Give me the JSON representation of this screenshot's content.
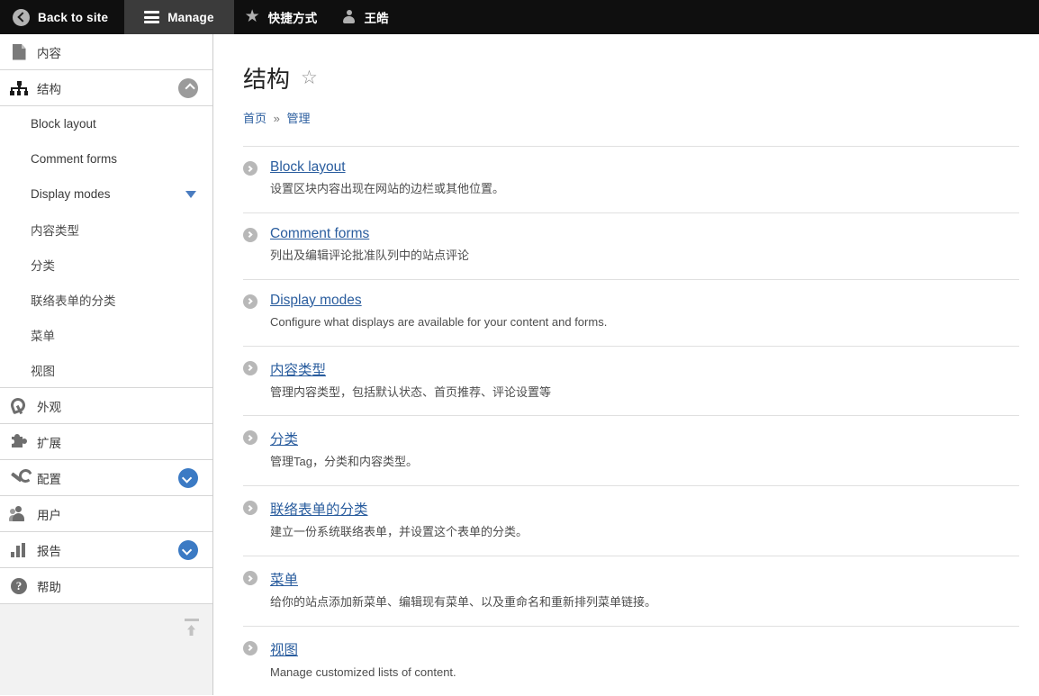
{
  "toolbar": {
    "back_label": "Back to site",
    "back_icon": "circle-left-chevron-icon",
    "manage_label": "Manage",
    "manage_icon": "hamburger-icon",
    "shortcuts_label": "快捷方式",
    "shortcuts_icon": "star-icon",
    "account_label": "王皓",
    "account_icon": "person-icon",
    "active_tab": "Manage"
  },
  "sidebar": {
    "items": [
      {
        "label": "内容",
        "icon": "document-icon",
        "toggle": null
      },
      {
        "label": "结构",
        "icon": "structure-tree-icon",
        "toggle": "chevron-up-gray"
      },
      {
        "label": "外观",
        "icon": "paintbrush-icon",
        "toggle": null
      },
      {
        "label": "扩展",
        "icon": "puzzle-piece-icon",
        "toggle": null
      },
      {
        "label": "配置",
        "icon": "wrench-icon",
        "toggle": "chevron-down-blue"
      },
      {
        "label": "用户",
        "icon": "users-icon",
        "toggle": null
      },
      {
        "label": "报告",
        "icon": "bar-chart-icon",
        "toggle": "chevron-down-blue"
      },
      {
        "label": "帮助",
        "icon": "question-circle-icon",
        "toggle": null
      }
    ],
    "structure_subitems": [
      {
        "label": "Block layout",
        "has_arrow": false
      },
      {
        "label": "Comment forms",
        "has_arrow": false
      },
      {
        "label": "Display modes",
        "has_arrow": true
      },
      {
        "label": "内容类型",
        "has_arrow": false
      },
      {
        "label": "分类",
        "has_arrow": false
      },
      {
        "label": "联络表单的分类",
        "has_arrow": false
      },
      {
        "label": "菜单",
        "has_arrow": false
      },
      {
        "label": "视图",
        "has_arrow": false
      }
    ],
    "collapse_icon": "collapse-toolbar-up-icon"
  },
  "main": {
    "title": "结构",
    "favorite_icon": "star-outline-icon",
    "breadcrumb": {
      "home": "首页",
      "separator": "»",
      "current": "管理"
    },
    "items": [
      {
        "title": "Block layout",
        "description": "设置区块内容出现在网站的边栏或其他位置。",
        "hovered": false
      },
      {
        "title": "Comment forms",
        "description": "列出及编辑评论批准队列中的站点评论",
        "hovered": false
      },
      {
        "title": "Display modes",
        "description": "Configure what displays are available for your content and forms.",
        "hovered": false
      },
      {
        "title": "内容类型",
        "description": "管理内容类型，包括默认状态、首页推荐、评论设置等",
        "hovered": false
      },
      {
        "title": "分类",
        "description": "管理Tag，分类和内容类型。",
        "hovered": false
      },
      {
        "title": "联络表单的分类",
        "description": "建立一份系统联络表单，并设置这个表单的分类。",
        "hovered": true
      },
      {
        "title": "菜单",
        "description": "给你的站点添加新菜单、编辑现有菜单、以及重命名和重新排列菜单链接。",
        "hovered": false
      },
      {
        "title": "视图",
        "description": "Manage customized lists of content.",
        "hovered": false
      }
    ]
  },
  "colors": {
    "toolbar_bg": "#0f0f0f",
    "toolbar_active": "#3b3b3b",
    "link_blue": "#2a5d9e",
    "accent_blue": "#3b7ac4",
    "sidebar_bg": "#f2f2f2"
  }
}
